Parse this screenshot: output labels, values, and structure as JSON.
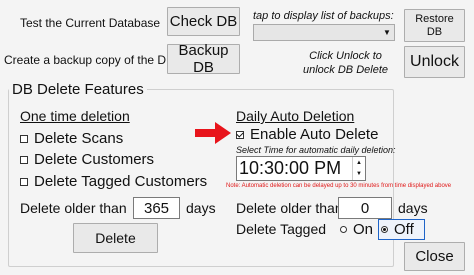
{
  "top": {
    "test_label": "Test the Current Database",
    "check_db_button": "Check DB",
    "backup_label": "Create a backup copy of the DB",
    "backup_db_button": "Backup DB",
    "backups_hint": "tap to display list of backups:",
    "backups_select_value": "",
    "restore_db_button": "Restore DB",
    "unlock_hint": "Click Unlock to unlock DB Delete",
    "unlock_button": "Unlock"
  },
  "delete_features": {
    "group_title": "DB Delete Features",
    "one_time": {
      "heading": "One time deletion",
      "options": [
        {
          "label": "Delete Scans",
          "checked": false
        },
        {
          "label": "Delete Customers",
          "checked": false
        },
        {
          "label": "Delete Tagged Customers",
          "checked": false
        }
      ],
      "older_than_label": "Delete older than",
      "older_than_value": "365",
      "days_label": "days",
      "delete_button": "Delete"
    },
    "daily_auto": {
      "heading": "Daily Auto Deletion",
      "enable_label": "Enable Auto Delete",
      "enable_checked": true,
      "time_hint": "Select Time for automatic daily deletion:",
      "time_value": "10:30:00 PM",
      "note": "Note: Automatic deletion can be delayed up to 30 minutes from time displayed above",
      "older_than_label": "Delete older than",
      "older_than_value": "0",
      "days_label": "days",
      "tagged_label": "Delete Tagged",
      "radio_on_label": "On",
      "radio_off_label": "Off",
      "radio_selected": "Off"
    }
  },
  "close_button": "Close",
  "colors": {
    "arrow": "#e8141b",
    "note_text": "#e01818",
    "background": "#f4f4f4"
  }
}
